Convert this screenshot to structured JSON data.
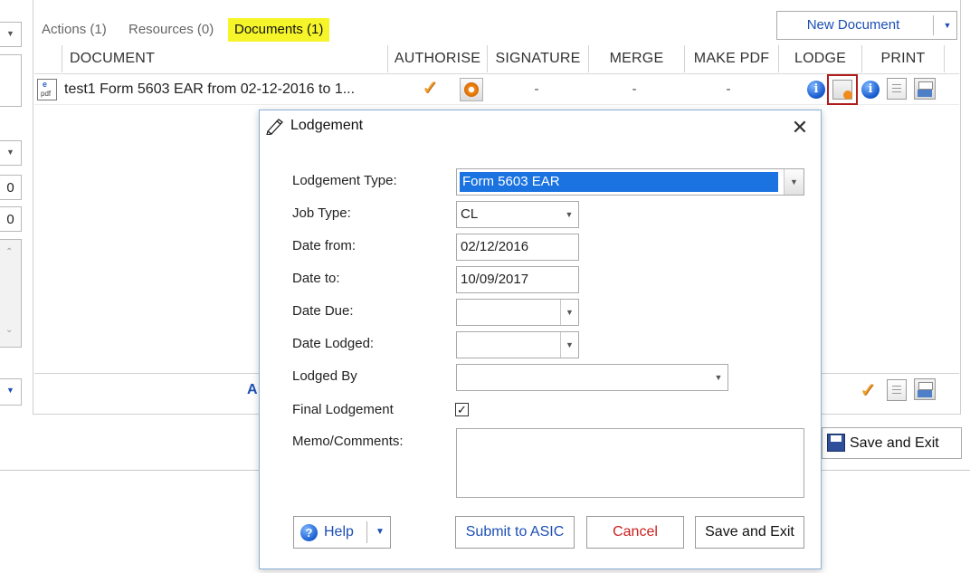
{
  "tabs": [
    {
      "label": "Actions (1)"
    },
    {
      "label": "Resources (0)"
    },
    {
      "label": "Documents (1)"
    }
  ],
  "new_document": {
    "label": "New Document"
  },
  "grid": {
    "columns": [
      "DOCUMENT",
      "AUTHORISE",
      "SIGNATURE",
      "MERGE",
      "MAKE PDF",
      "LODGE",
      "PRINT"
    ],
    "rows": [
      {
        "document": "test1 Form 5603 EAR from 02-12-2016 to 1...",
        "signature": "-",
        "merge": "-",
        "make_pdf": "-"
      }
    ],
    "footer_text": "A"
  },
  "left_panel": {
    "values": [
      "0",
      "0"
    ]
  },
  "background_save_button": {
    "label": "Save and Exit"
  },
  "dialog": {
    "title": "Lodgement",
    "fields": {
      "lodgement_type": {
        "label": "Lodgement Type:",
        "value": "Form 5603 EAR"
      },
      "job_type": {
        "label": "Job Type:",
        "value": "CL"
      },
      "date_from": {
        "label": "Date from:",
        "value": "02/12/2016"
      },
      "date_to": {
        "label": "Date to:",
        "value": "10/09/2017"
      },
      "date_due": {
        "label": "Date Due:",
        "value": ""
      },
      "date_lodged": {
        "label": "Date Lodged:",
        "value": ""
      },
      "lodged_by": {
        "label": "Lodged By",
        "value": ""
      },
      "final_lodgement": {
        "label": "Final Lodgement",
        "checked": true
      },
      "memo": {
        "label": "Memo/Comments:",
        "value": ""
      }
    },
    "buttons": {
      "help": "Help",
      "submit": "Submit to ASIC",
      "cancel": "Cancel",
      "save_exit": "Save and Exit"
    }
  },
  "colors": {
    "accent_blue": "#1d4fb4",
    "tab_highlight": "#f5f52a",
    "selection": "#1a73e0",
    "cancel_red": "#cc1f1f",
    "lodge_highlight_border": "#b01c1c"
  }
}
